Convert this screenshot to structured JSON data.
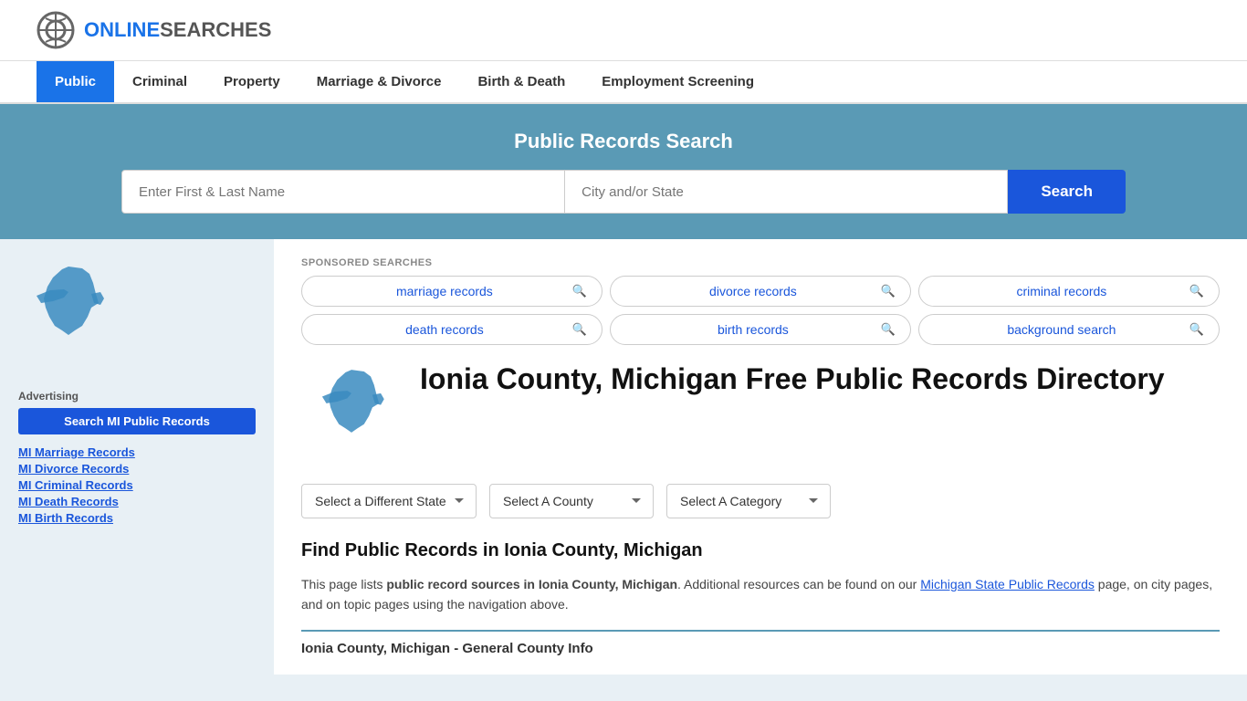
{
  "logo": {
    "icon_alt": "OnlineSearches logo icon",
    "brand_prefix": "ONLINE",
    "brand_suffix": "SEARCHES"
  },
  "nav": {
    "items": [
      {
        "label": "Public",
        "active": true
      },
      {
        "label": "Criminal",
        "active": false
      },
      {
        "label": "Property",
        "active": false
      },
      {
        "label": "Marriage & Divorce",
        "active": false
      },
      {
        "label": "Birth & Death",
        "active": false
      },
      {
        "label": "Employment Screening",
        "active": false
      }
    ]
  },
  "hero": {
    "title": "Public Records Search",
    "name_placeholder": "Enter First & Last Name",
    "location_placeholder": "City and/or State",
    "search_btn": "Search"
  },
  "sponsored": {
    "label": "SPONSORED SEARCHES",
    "pills": [
      {
        "text": "marriage records"
      },
      {
        "text": "divorce records"
      },
      {
        "text": "criminal records"
      },
      {
        "text": "death records"
      },
      {
        "text": "birth records"
      },
      {
        "text": "background search"
      }
    ]
  },
  "page": {
    "title": "Ionia County, Michigan Free Public Records Directory",
    "dropdowns": {
      "state": "Select a Different State",
      "county": "Select A County",
      "category": "Select A Category"
    },
    "find_title": "Find Public Records in Ionia County, Michigan",
    "find_description_1": "This page lists ",
    "find_bold": "public record sources in Ionia County, Michigan",
    "find_description_2": ". Additional resources can be found on our ",
    "find_link_text": "Michigan State Public Records",
    "find_description_3": " page, on city pages, and on topic pages using the navigation above.",
    "general_info": "Ionia County, Michigan - General County Info"
  },
  "sidebar": {
    "advertising_label": "Advertising",
    "ad_btn": "Search MI Public Records",
    "links": [
      {
        "label": "MI Marriage Records"
      },
      {
        "label": "MI Divorce Records"
      },
      {
        "label": "MI Criminal Records"
      },
      {
        "label": "MI Death Records"
      },
      {
        "label": "MI Birth Records"
      }
    ]
  },
  "colors": {
    "hero_bg": "#5a9ab5",
    "nav_active_bg": "#1a73e8",
    "search_btn_bg": "#1a56db",
    "link_color": "#1a56db",
    "map_fill": "#3a8bbf"
  }
}
